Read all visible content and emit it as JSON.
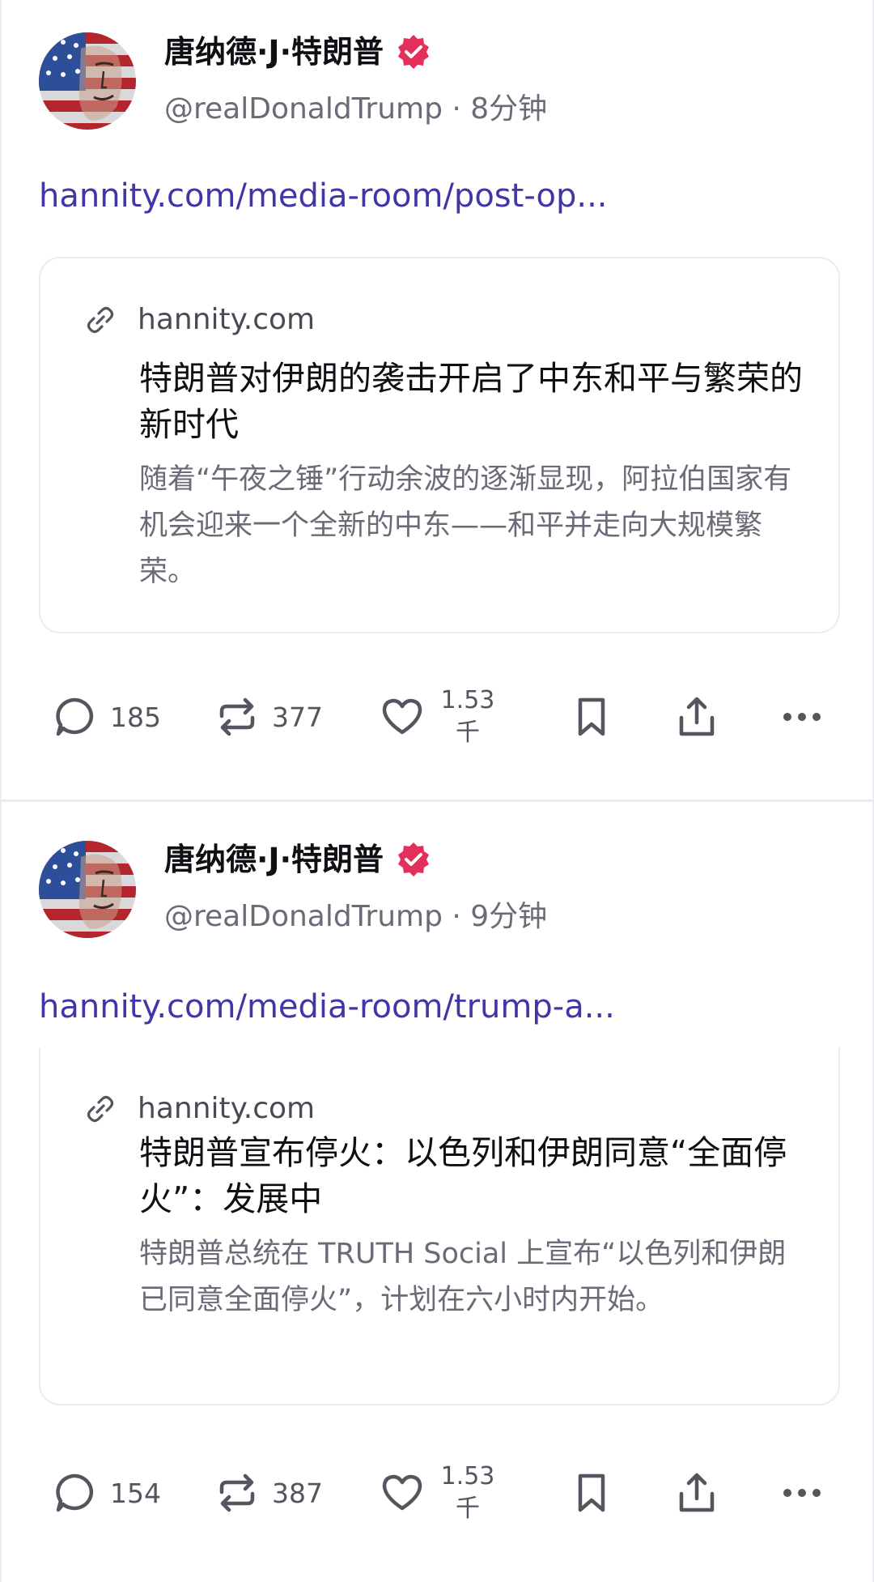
{
  "colors": {
    "link": "#4136a8",
    "verified": "#e3305a",
    "muted": "#6b6b78",
    "icon": "#55555f"
  },
  "posts": [
    {
      "author_name": "唐纳德·J·特朗普",
      "handle": "@realDonaldTrump",
      "time": "· 8分钟",
      "link_text": "hannity.com/media-room/post-op...",
      "card": {
        "domain": "hannity.com",
        "title": "特朗普对伊朗的袭击开启了中东和平与繁荣的新时代",
        "description": "随着“午夜之锤”行动余波的逐渐显现，阿拉伯国家有机会迎来一个全新的中东——和平并走向大规模繁荣。"
      },
      "actions": {
        "replies": "185",
        "retruths": "377",
        "likes_number": "1.53",
        "likes_unit": "千"
      }
    },
    {
      "author_name": "唐纳德·J·特朗普",
      "handle": "@realDonaldTrump",
      "time": "· 9分钟",
      "link_text": "hannity.com/media-room/trump-a...",
      "card": {
        "domain": "hannity.com",
        "title": "特朗普宣布停火：以色列和伊朗同意“全面停火”：发展中",
        "description": "特朗普总统在 TRUTH Social 上宣布“以色列和伊朗已同意全面停火”，计划在六小时内开始。"
      },
      "actions": {
        "replies": "154",
        "retruths": "387",
        "likes_number": "1.53",
        "likes_unit": "千"
      }
    }
  ],
  "icons": {
    "avatar": "avatar-flag-portrait",
    "verified": "verified-badge-icon",
    "link": "link-icon",
    "reply": "reply-icon",
    "retruth": "retruth-icon",
    "like": "heart-icon",
    "bookmark": "bookmark-icon",
    "share": "share-icon",
    "more": "more-icon"
  }
}
